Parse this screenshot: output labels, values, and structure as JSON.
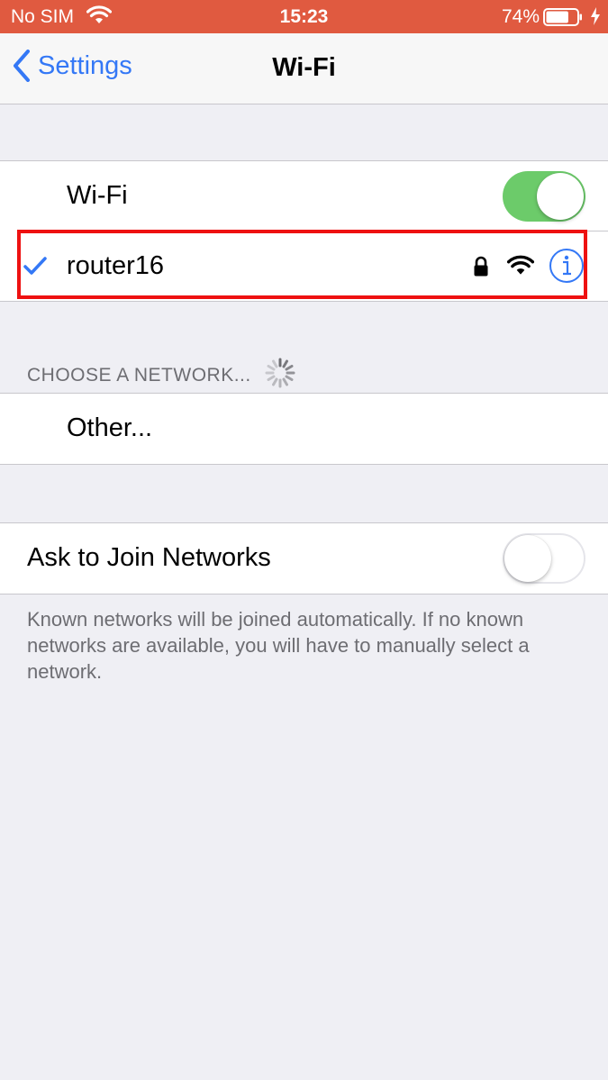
{
  "status_bar": {
    "carrier": "No SIM",
    "time": "15:23",
    "battery_percent": "74%",
    "battery_level": 0.74,
    "icons": [
      "wifi-icon",
      "battery-icon",
      "charging-bolt-icon"
    ],
    "background_color": "#e05a40"
  },
  "nav": {
    "back_label": "Settings",
    "title": "Wi-Fi",
    "accent_color": "#3478f6"
  },
  "wifi": {
    "label": "Wi-Fi",
    "enabled": true,
    "toggle_on_color": "#6ccb6a"
  },
  "connected_network": {
    "name": "router16",
    "selected": true,
    "secured": true,
    "icons": [
      "checkmark-icon",
      "lock-icon",
      "wifi-signal-icon",
      "info-icon"
    ],
    "highlight_color": "#ee1111"
  },
  "choose_network": {
    "header": "CHOOSE A NETWORK...",
    "other_label": "Other..."
  },
  "ask_to_join": {
    "label": "Ask to Join Networks",
    "enabled": false,
    "footer": "Known networks will be joined automatically. If no known networks are available, you will have to manually select a network."
  }
}
